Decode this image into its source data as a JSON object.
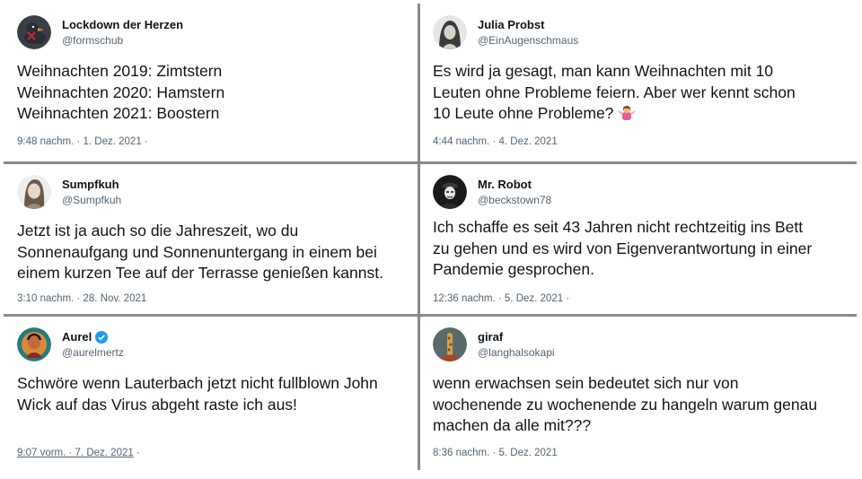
{
  "tweets": [
    {
      "name": "Lockdown der Herzen",
      "handle": "@formschub",
      "text": "Weihnachten 2019: Zimtstern\nWeihnachten 2020: Hamstern\nWeihnachten 2021: Boostern",
      "meta": "9:48 nachm. · 1. Dez. 2021 ·",
      "avatar_icon": "duck-avatar-icon",
      "verified": false
    },
    {
      "name": "Julia Probst",
      "handle": "@EinAugenschmaus",
      "text": "Es wird ja gesagt, man kann Weihnachten mit 10\nLeuten ohne Probleme feiern. Aber wer kennt schon\n10 Leute ohne Probleme?",
      "emoji": "woman-shrugging-emoji",
      "meta": "4:44 nachm. · 4. Dez. 2021",
      "avatar_icon": "woman-portrait-avatar-icon",
      "verified": false
    },
    {
      "name": "Sumpfkuh",
      "handle": "@Sumpfkuh",
      "text": "Jetzt ist ja auch so die Jahreszeit, wo du\nSonnenaufgang und Sonnenuntergang in einem bei\neinem kurzen Tee auf der Terrasse genießen kannst.",
      "meta": "3:10 nachm. · 28. Nov. 2021",
      "avatar_icon": "woman-portrait-avatar-icon",
      "verified": false
    },
    {
      "name": "Mr. Robot",
      "handle": "@beckstown78",
      "text": "Ich schaffe es seit 43 Jahren nicht rechtzeitig ins Bett\nzu gehen und es wird von Eigenverantwortung in einer\nPandemie gesprochen.",
      "meta": "12:36 nachm. · 5. Dez. 2021 ·",
      "avatar_icon": "masked-figure-avatar-icon",
      "verified": false
    },
    {
      "name": "Aurel",
      "handle": "@aurelmertz",
      "text": "Schwöre wenn Lauterbach jetzt nicht fullblown John\nWick auf das Virus abgeht raste ich aus!",
      "meta": "9:07 vorm. · 7. Dez. 2021",
      "avatar_icon": "colorful-portrait-avatar-icon",
      "verified": true
    },
    {
      "name": "giraf",
      "handle": "@langhalsokapi",
      "text": "wenn erwachsen sein bedeutet sich nur von\nwochenende zu wochenende zu hangeln warum genau\nmachen da alle mit???",
      "meta": "8:36 nachm. · 5. Dez. 2021",
      "avatar_icon": "giraffe-avatar-icon",
      "verified": false
    }
  ],
  "colors": {
    "text": "#0f1419",
    "secondary": "#536471",
    "verified": "#1d9bf0",
    "divider": "#8a8a8a"
  }
}
